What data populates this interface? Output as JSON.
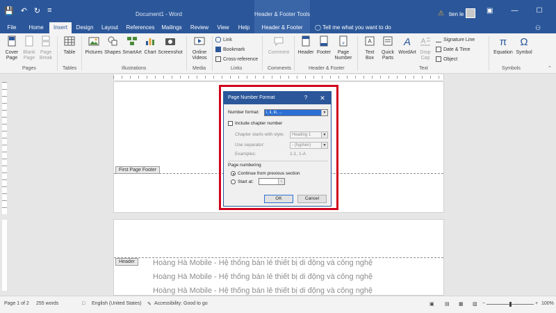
{
  "titlebar": {
    "doc_title": "Document1 - Word",
    "tools_title": "Header & Footer Tools",
    "user": "tien le",
    "qat": {
      "save": "💾",
      "undo": "↶",
      "redo": "↻",
      "more": "≡"
    },
    "warn": "⚠",
    "winbtns": {
      "ribbon": "▣",
      "min": "—",
      "max": "☐",
      "close": "✕"
    }
  },
  "tabs": [
    {
      "label": "File"
    },
    {
      "label": "Home"
    },
    {
      "label": "Insert"
    },
    {
      "label": "Design"
    },
    {
      "label": "Layout"
    },
    {
      "label": "References"
    },
    {
      "label": "Mailings"
    },
    {
      "label": "Review"
    },
    {
      "label": "View"
    },
    {
      "label": "Help"
    },
    {
      "label": "Header & Footer"
    }
  ],
  "tell_me": "Tell me what you want to do",
  "ribbon": {
    "cover_page": "Cover Page",
    "blank_page": "Blank Page",
    "page_break": "Page Break",
    "table": "Table",
    "pictures": "Pictures",
    "shapes": "Shapes",
    "smartart": "SmartArt",
    "chart": "Chart",
    "screenshot": "Screenshot",
    "online_videos": "Online Videos",
    "link": "Link",
    "bookmark": "Bookmark",
    "cross_reference": "Cross-reference",
    "comment": "Comment",
    "header": "Header",
    "footer": "Footer",
    "page_number": "Page Number",
    "text_box": "Text Box",
    "quick_parts": "Quick Parts",
    "wordart": "WordArt",
    "drop_cap": "Drop Cap",
    "signature_line": "Signature Line",
    "date_time": "Date & Time",
    "object": "Object",
    "equation": "Equation",
    "symbol": "Symbol",
    "groups": {
      "pages": "Pages",
      "tables": "Tables",
      "illustrations": "Illustrations",
      "media": "Media",
      "links": "Links",
      "comments": "Comments",
      "header_footer": "Header & Footer",
      "text": "Text",
      "symbols": "Symbols"
    }
  },
  "document": {
    "first_page_footer": "First Page Footer",
    "header_tag": "Header",
    "body_lines": [
      "Hoàng Hà Mobile - Hệ thống bán lẻ thiết bị di động và công nghệ",
      "Hoàng Hà Mobile - Hệ thống bán lẻ thiết bị di động và công nghệ",
      "Hoàng Hà Mobile - Hệ thống bán lẻ thiết bị di động và công nghệ"
    ]
  },
  "dialog": {
    "title": "Page Number Format",
    "help": "?",
    "close": "✕",
    "number_format_label": "Number format:",
    "number_format_value": "i, ii, iii, ...",
    "include_chapter": "Include chapter number",
    "chapter_style_label": "Chapter starts with style:",
    "chapter_style_value": "Heading 1",
    "separator_label": "Use separator:",
    "separator_value": "-   (hyphen)",
    "examples_label": "Examples:",
    "examples_value": "1-1, 1-A",
    "page_numbering": "Page numbering",
    "continue_label": "Continue from previous section",
    "start_at_label": "Start at:",
    "start_at_value": "",
    "ok": "OK",
    "cancel": "Cancel"
  },
  "status": {
    "page": "Page 1 of 2",
    "words": "255 words",
    "language": "English (United States)",
    "accessibility": "Accessibility: Good to go",
    "zoom": "100%",
    "zoom_minus": "−",
    "zoom_plus": "+"
  },
  "colors": {
    "brand": "#2b579a",
    "highlight": "#d0021b",
    "selection": "#2b6fd4"
  }
}
